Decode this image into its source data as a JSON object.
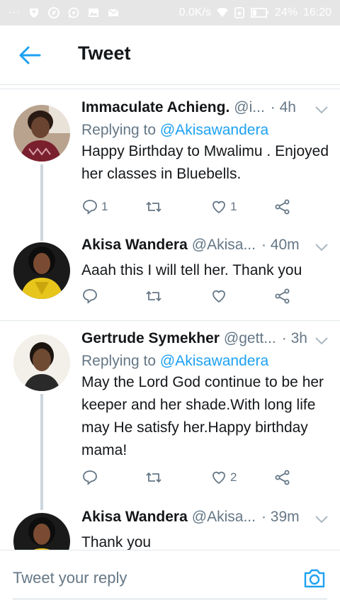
{
  "status_bar": {
    "dots": "···",
    "network": "0.0K/s",
    "battery": "24%",
    "time": "16:20"
  },
  "header": {
    "title": "Tweet"
  },
  "tweets": [
    {
      "name": "Immaculate Achieng.",
      "handle": "@i...",
      "time": "· 4h",
      "replying_label": "Replying to",
      "mention": "@Akisawandera",
      "text": "Happy Birthday to Mwalimu . Enjoyed her classes in Bluebells.",
      "reply_count": "1",
      "like_count": "1"
    },
    {
      "name": "Akisa Wandera",
      "handle": "@Akisa...",
      "time": "· 40m",
      "text": "Aaah this I will tell her. Thank you",
      "reply_count": "",
      "like_count": ""
    },
    {
      "name": "Gertrude Symekher",
      "handle": "@gett...",
      "time": "· 3h",
      "replying_label": "Replying to",
      "mention": "@Akisawandera",
      "text": "May the Lord God continue to be her keeper and her shade.With long life may He satisfy her.Happy birthday mama!",
      "reply_count": "",
      "like_count": "2"
    },
    {
      "name": "Akisa Wandera",
      "handle": "@Akisa...",
      "time": "· 39m",
      "text": "Thank you"
    }
  ],
  "compose": {
    "placeholder": "Tweet your reply"
  },
  "colors": {
    "accent": "#1da1f2",
    "secondary_text": "#657786",
    "divider": "#e1e8ed"
  }
}
